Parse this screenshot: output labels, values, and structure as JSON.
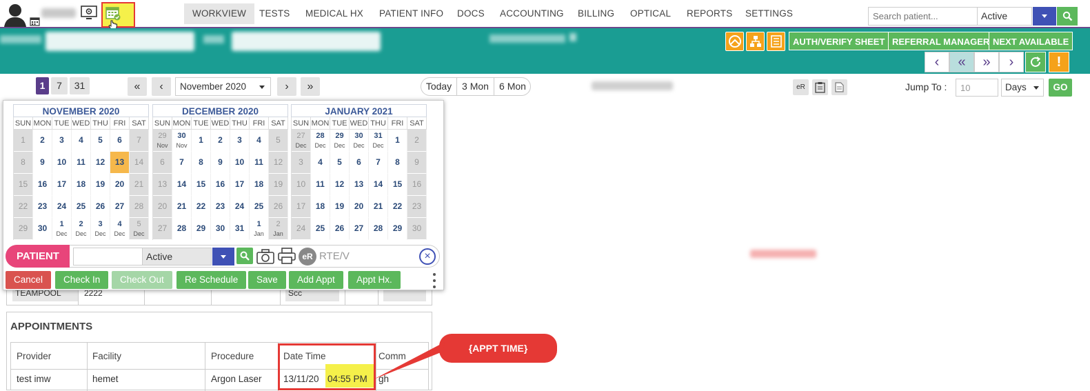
{
  "topbar": {
    "nav": [
      "WORKVIEW",
      "TESTS",
      "MEDICAL HX",
      "PATIENT INFO",
      "DOCS",
      "ACCOUNTING",
      "BILLING",
      "OPTICAL",
      "REPORTS",
      "SETTINGS"
    ],
    "search_placeholder": "Search patient...",
    "status_value": "Active"
  },
  "teal": {
    "auth_label": "AUTH/VERIFY SHEET",
    "referral_label": "REFERRAL MANAGER",
    "next_label": "NEXT AVAILABLE"
  },
  "datenav": {
    "view_1": "1",
    "view_7": "7",
    "view_31": "31",
    "month_value": "November 2020",
    "today": "Today",
    "three_mon": "3 Mon",
    "six_mon": "6 Mon",
    "er_label": "eR",
    "jump_label": "Jump To :",
    "jump_value": "10",
    "jump_unit": "Days",
    "go_label": "GO"
  },
  "calendar": {
    "day_headers": [
      "SUN",
      "MON",
      "TUE",
      "WED",
      "THU",
      "FRI",
      "SAT"
    ],
    "months": [
      {
        "title": "NOVEMBER 2020",
        "weeks": [
          [
            [
              "1",
              ""
            ],
            [
              "2",
              ""
            ],
            [
              "3",
              ""
            ],
            [
              "4",
              ""
            ],
            [
              "5",
              ""
            ],
            [
              "6",
              ""
            ],
            [
              "7",
              ""
            ]
          ],
          [
            [
              "8",
              ""
            ],
            [
              "9",
              ""
            ],
            [
              "10",
              ""
            ],
            [
              "11",
              ""
            ],
            [
              "12",
              ""
            ],
            [
              "13",
              ""
            ],
            [
              "14",
              ""
            ]
          ],
          [
            [
              "15",
              ""
            ],
            [
              "16",
              ""
            ],
            [
              "17",
              ""
            ],
            [
              "18",
              ""
            ],
            [
              "19",
              ""
            ],
            [
              "20",
              ""
            ],
            [
              "21",
              ""
            ]
          ],
          [
            [
              "22",
              ""
            ],
            [
              "23",
              ""
            ],
            [
              "24",
              ""
            ],
            [
              "25",
              ""
            ],
            [
              "26",
              ""
            ],
            [
              "27",
              ""
            ],
            [
              "28",
              ""
            ]
          ],
          [
            [
              "29",
              ""
            ],
            [
              "30",
              ""
            ],
            [
              "1",
              "Dec"
            ],
            [
              "2",
              "Dec"
            ],
            [
              "3",
              "Dec"
            ],
            [
              "4",
              "Dec"
            ],
            [
              "5",
              "Dec"
            ]
          ]
        ],
        "selected": "13"
      },
      {
        "title": "DECEMBER 2020",
        "weeks": [
          [
            [
              "29",
              "Nov"
            ],
            [
              "30",
              "Nov"
            ],
            [
              "1",
              ""
            ],
            [
              "2",
              ""
            ],
            [
              "3",
              ""
            ],
            [
              "4",
              ""
            ],
            [
              "5",
              ""
            ]
          ],
          [
            [
              "6",
              ""
            ],
            [
              "7",
              ""
            ],
            [
              "8",
              ""
            ],
            [
              "9",
              ""
            ],
            [
              "10",
              ""
            ],
            [
              "11",
              ""
            ],
            [
              "12",
              ""
            ]
          ],
          [
            [
              "13",
              ""
            ],
            [
              "14",
              ""
            ],
            [
              "15",
              ""
            ],
            [
              "16",
              ""
            ],
            [
              "17",
              ""
            ],
            [
              "18",
              ""
            ],
            [
              "19",
              ""
            ]
          ],
          [
            [
              "20",
              ""
            ],
            [
              "21",
              ""
            ],
            [
              "22",
              ""
            ],
            [
              "23",
              ""
            ],
            [
              "24",
              ""
            ],
            [
              "25",
              ""
            ],
            [
              "26",
              ""
            ]
          ],
          [
            [
              "27",
              ""
            ],
            [
              "28",
              ""
            ],
            [
              "29",
              ""
            ],
            [
              "30",
              ""
            ],
            [
              "31",
              ""
            ],
            [
              "1",
              "Jan"
            ],
            [
              "2",
              "Jan"
            ]
          ]
        ]
      },
      {
        "title": "JANUARY 2021",
        "weeks": [
          [
            [
              "27",
              "Dec"
            ],
            [
              "28",
              "Dec"
            ],
            [
              "29",
              "Dec"
            ],
            [
              "30",
              "Dec"
            ],
            [
              "31",
              "Dec"
            ],
            [
              "1",
              ""
            ],
            [
              "2",
              ""
            ]
          ],
          [
            [
              "3",
              ""
            ],
            [
              "4",
              ""
            ],
            [
              "5",
              ""
            ],
            [
              "6",
              ""
            ],
            [
              "7",
              ""
            ],
            [
              "8",
              ""
            ],
            [
              "9",
              ""
            ]
          ],
          [
            [
              "10",
              ""
            ],
            [
              "11",
              ""
            ],
            [
              "12",
              ""
            ],
            [
              "13",
              ""
            ],
            [
              "14",
              ""
            ],
            [
              "15",
              ""
            ],
            [
              "16",
              ""
            ]
          ],
          [
            [
              "17",
              ""
            ],
            [
              "18",
              ""
            ],
            [
              "19",
              ""
            ],
            [
              "20",
              ""
            ],
            [
              "21",
              ""
            ],
            [
              "22",
              ""
            ],
            [
              "23",
              ""
            ]
          ],
          [
            [
              "24",
              ""
            ],
            [
              "25",
              ""
            ],
            [
              "26",
              ""
            ],
            [
              "27",
              ""
            ],
            [
              "28",
              ""
            ],
            [
              "29",
              ""
            ],
            [
              "30",
              ""
            ]
          ]
        ]
      }
    ]
  },
  "patient": {
    "label": "PATIENT",
    "status_value": "Active",
    "er_label": "eR",
    "rte_label": "RTE/V"
  },
  "actions": {
    "cancel": "Cancel",
    "check_in": "Check In",
    "check_out": "Check Out",
    "reschedule": "Re Schedule",
    "save": "Save",
    "add_appt": "Add Appt",
    "appt_hx": "Appt Hx."
  },
  "partial_row": {
    "c1": "TEAMPOOL",
    "c2": "2222",
    "c3": "Scc"
  },
  "appointments": {
    "title": "APPOINTMENTS",
    "headers": [
      "Provider",
      "Facility",
      "Procedure",
      "Date Time",
      "Comm"
    ],
    "row": {
      "provider": "test imw",
      "facility": "hemet",
      "procedure": "Argon Laser",
      "date": "13/11/20",
      "time": "04:55 PM",
      "comment": "gh"
    }
  },
  "callout": {
    "label": "{APPT TIME}"
  },
  "colors": {
    "teal": "#1a9d93",
    "green": "#5cb85c",
    "purple": "#6a4a8c",
    "orange": "#f5a21a",
    "red_annotation": "#e53935",
    "highlight": "#f5f04a"
  }
}
